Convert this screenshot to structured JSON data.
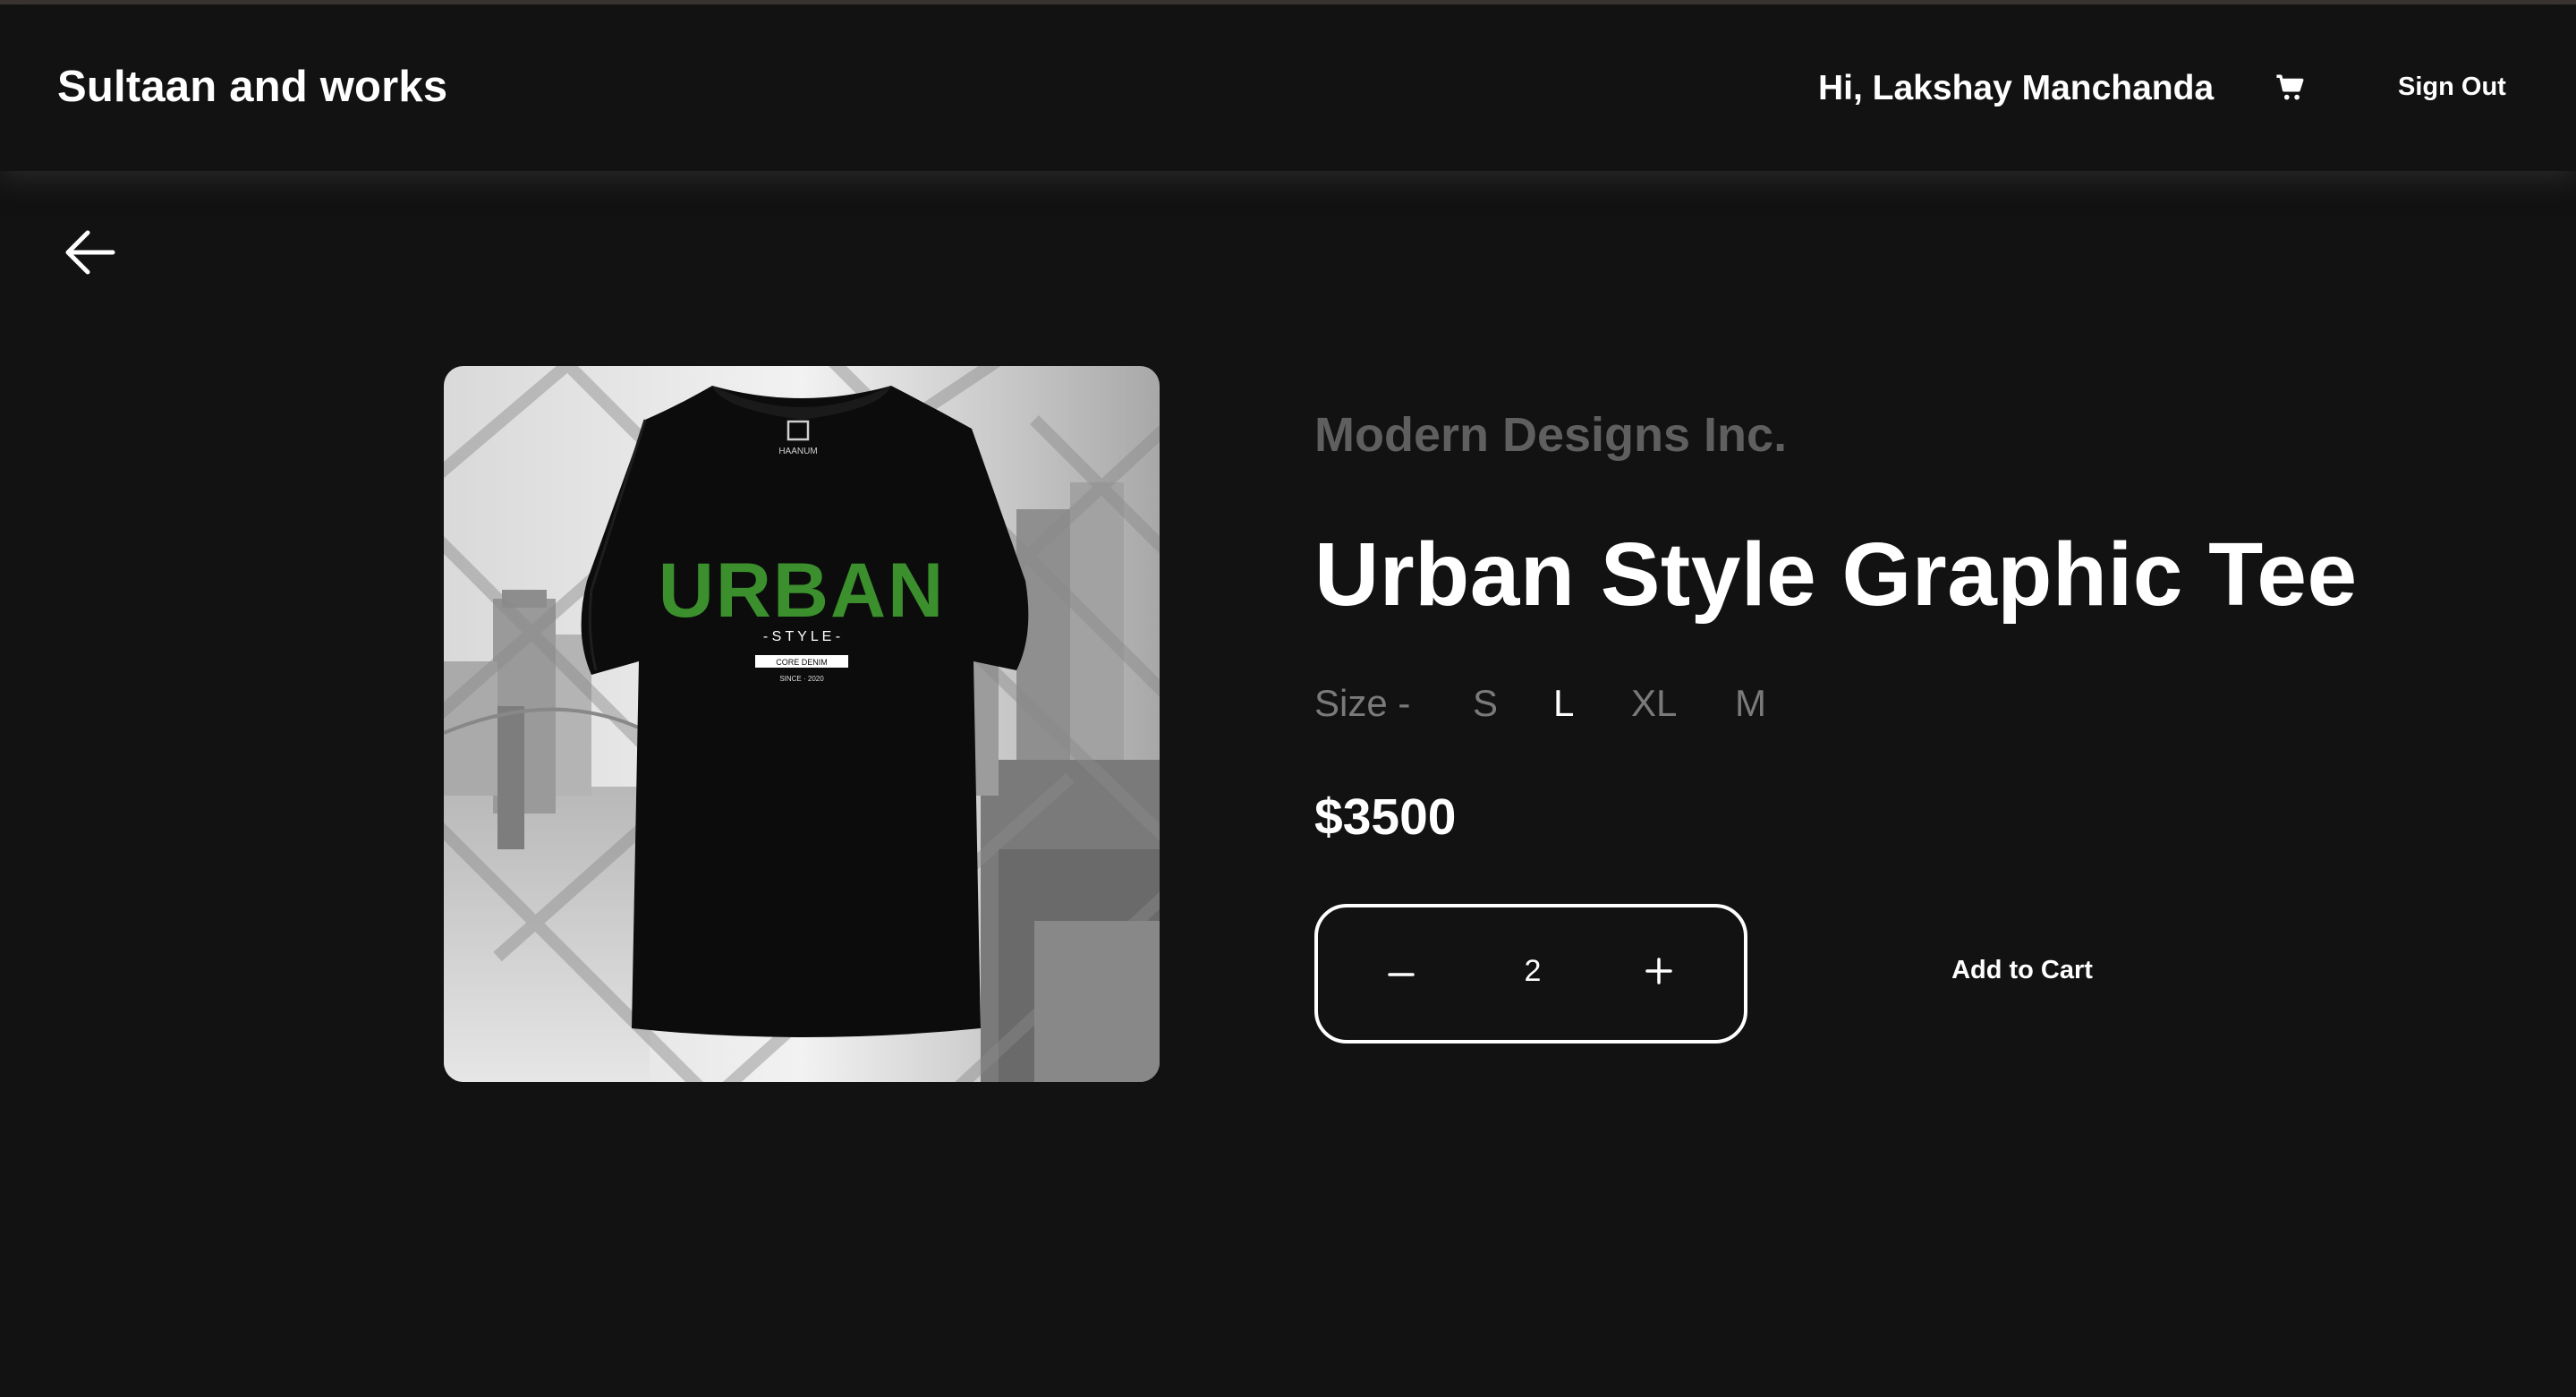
{
  "header": {
    "brand": "Sultaan and works",
    "greeting": "Hi, Lakshay Manchanda",
    "cart_icon": "cart-icon",
    "sign_out_label": "Sign Out"
  },
  "navigation": {
    "back_icon": "arrow-left-icon"
  },
  "product": {
    "image": {
      "description_icon": "tshirt-image",
      "tshirt_logo_text": "HAANUM",
      "print_main": "URBAN",
      "print_sub": "- S T Y L E -",
      "print_tag": "CORE DENIM",
      "print_since": "SINCE · 2020"
    },
    "company": "Modern Designs Inc.",
    "title": "Urban Style Graphic Tee",
    "size_label": "Size -",
    "sizes": [
      "S",
      "L",
      "XL",
      "M"
    ],
    "selected_size": "L",
    "price": "$3500",
    "quantity": "2",
    "add_to_cart_label": "Add to Cart"
  },
  "colors": {
    "background": "#121212",
    "text": "#ffffff",
    "muted": "#7a7a7a",
    "company": "#5f5f5f",
    "print_green": "#3b8f2c"
  }
}
